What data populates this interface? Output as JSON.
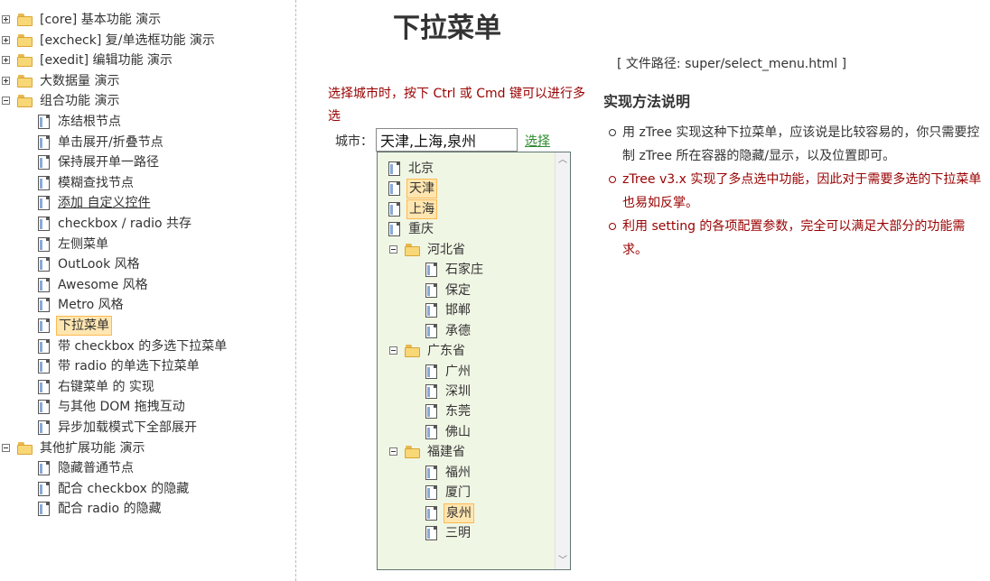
{
  "left_tree": [
    {
      "label": "[core] 基本功能 演示",
      "type": "folder",
      "switch": "plus",
      "level": 0
    },
    {
      "label": "[excheck] 复/单选框功能 演示",
      "type": "folder",
      "switch": "plus",
      "level": 0
    },
    {
      "label": "[exedit] 编辑功能 演示",
      "type": "folder",
      "switch": "plus",
      "level": 0
    },
    {
      "label": "大数据量 演示",
      "type": "folder",
      "switch": "plus",
      "level": 0
    },
    {
      "label": "组合功能 演示",
      "type": "folder",
      "switch": "minus",
      "level": 0
    },
    {
      "label": "冻结根节点",
      "type": "doc",
      "level": 1
    },
    {
      "label": "单击展开/折叠节点",
      "type": "doc",
      "level": 1
    },
    {
      "label": "保持展开单一路径",
      "type": "doc",
      "level": 1
    },
    {
      "label": "模糊查找节点",
      "type": "doc",
      "level": 1
    },
    {
      "label": "添加 自定义控件",
      "type": "doc",
      "level": 1,
      "underline": true
    },
    {
      "label": "checkbox / radio 共存",
      "type": "doc",
      "level": 1
    },
    {
      "label": "左侧菜单",
      "type": "doc",
      "level": 1
    },
    {
      "label": "OutLook 风格",
      "type": "doc",
      "level": 1
    },
    {
      "label": "Awesome 风格",
      "type": "doc",
      "level": 1
    },
    {
      "label": "Metro 风格",
      "type": "doc",
      "level": 1
    },
    {
      "label": "下拉菜单",
      "type": "doc",
      "level": 1,
      "selected": true
    },
    {
      "label": "带 checkbox 的多选下拉菜单",
      "type": "doc",
      "level": 1
    },
    {
      "label": "带 radio 的单选下拉菜单",
      "type": "doc",
      "level": 1
    },
    {
      "label": "右键菜单 的 实现",
      "type": "doc",
      "level": 1
    },
    {
      "label": "与其他 DOM 拖拽互动",
      "type": "doc",
      "level": 1
    },
    {
      "label": "异步加载模式下全部展开",
      "type": "doc",
      "level": 1
    },
    {
      "label": "其他扩展功能 演示",
      "type": "folder",
      "switch": "minus",
      "level": 0
    },
    {
      "label": "隐藏普通节点",
      "type": "doc",
      "level": 1
    },
    {
      "label": "配合 checkbox 的隐藏",
      "type": "doc",
      "level": 1
    },
    {
      "label": "配合 radio 的隐藏",
      "type": "doc",
      "level": 1
    }
  ],
  "page": {
    "title": "下拉菜单",
    "file_path": "[ 文件路径: super/select_menu.html ]",
    "hint": "选择城市时，按下 Ctrl 或 Cmd 键可以进行多选",
    "city_label": "城市：",
    "city_value": "天津,上海,泉州",
    "select_link": "选择"
  },
  "dropdown_tree": [
    {
      "label": "北京",
      "type": "doc",
      "level": 0
    },
    {
      "label": "天津",
      "type": "doc",
      "level": 0,
      "selected": true
    },
    {
      "label": "上海",
      "type": "doc",
      "level": 0,
      "selected": true
    },
    {
      "label": "重庆",
      "type": "doc",
      "level": 0
    },
    {
      "label": "河北省",
      "type": "folder",
      "switch": "minus",
      "level": 0
    },
    {
      "label": "石家庄",
      "type": "doc",
      "level": 1
    },
    {
      "label": "保定",
      "type": "doc",
      "level": 1
    },
    {
      "label": "邯郸",
      "type": "doc",
      "level": 1
    },
    {
      "label": "承德",
      "type": "doc",
      "level": 1
    },
    {
      "label": "广东省",
      "type": "folder",
      "switch": "minus",
      "level": 0
    },
    {
      "label": "广州",
      "type": "doc",
      "level": 1
    },
    {
      "label": "深圳",
      "type": "doc",
      "level": 1
    },
    {
      "label": "东莞",
      "type": "doc",
      "level": 1
    },
    {
      "label": "佛山",
      "type": "doc",
      "level": 1
    },
    {
      "label": "福建省",
      "type": "folder",
      "switch": "minus",
      "level": 0
    },
    {
      "label": "福州",
      "type": "doc",
      "level": 1
    },
    {
      "label": "厦门",
      "type": "doc",
      "level": 1
    },
    {
      "label": "泉州",
      "type": "doc",
      "level": 1,
      "selected": true
    },
    {
      "label": "三明",
      "type": "doc",
      "level": 1
    }
  ],
  "description": {
    "title": "实现方法说明",
    "items": [
      {
        "text": "用 zTree 实现这种下拉菜单，应该说是比较容易的，你只需要控制 zTree 所在容器的隐藏/显示，以及位置即可。",
        "color": "#333333"
      },
      {
        "text": "zTree v3.x 实现了多点选中功能，因此对于需要多选的下拉菜单也易如反掌。",
        "color": "#990000"
      },
      {
        "text": "利用 setting 的各项配置参数，完全可以满足大部分的功能需求。",
        "color": "#990000"
      }
    ]
  },
  "scroll_arrows": {
    "up": "︿",
    "down": "﹀"
  }
}
